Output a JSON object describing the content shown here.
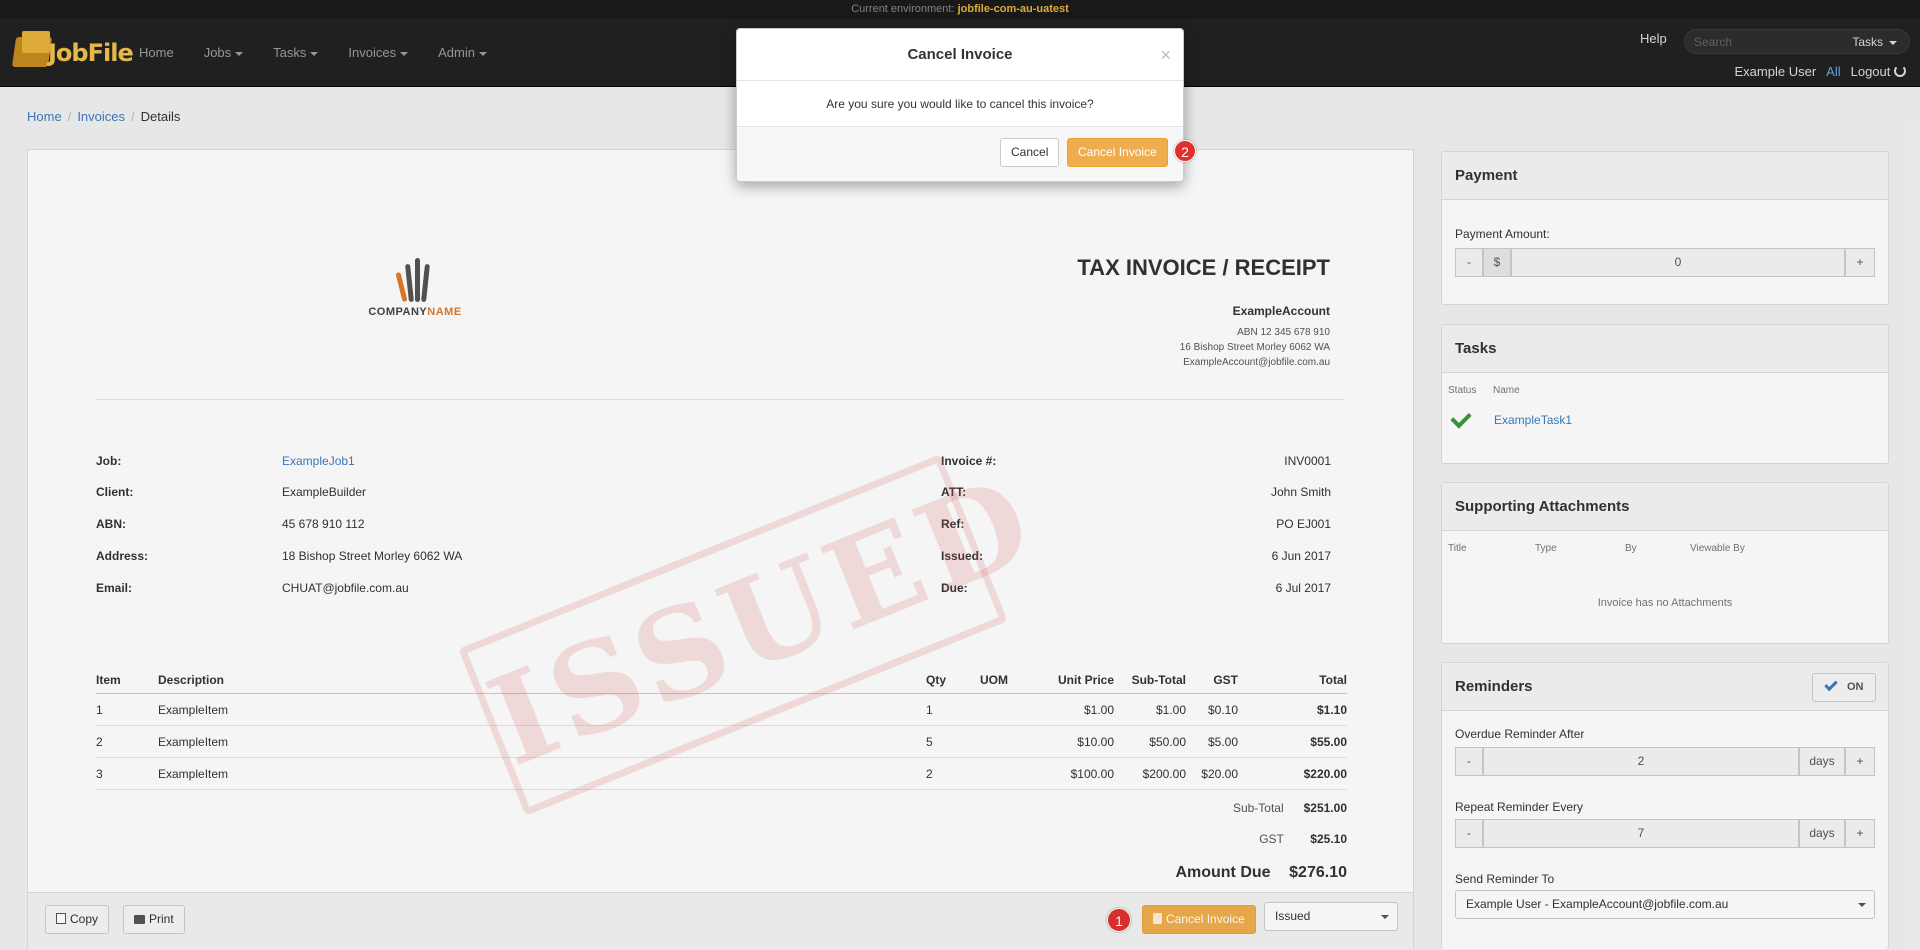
{
  "env": {
    "label": "Current environment:",
    "name": "jobfile-com-au-uatest"
  },
  "nav": {
    "logo_text": "JobFile",
    "items": [
      {
        "label": "Home",
        "dropdown": false
      },
      {
        "label": "Jobs",
        "dropdown": true
      },
      {
        "label": "Tasks",
        "dropdown": true
      },
      {
        "label": "Invoices",
        "dropdown": true
      },
      {
        "label": "Admin",
        "dropdown": true
      }
    ],
    "help": "Help",
    "search_placeholder": "Search",
    "search_scope": "Tasks",
    "user": "Example User",
    "all": "All",
    "logout": "Logout"
  },
  "breadcrumb": {
    "home": "Home",
    "invoices": "Invoices",
    "current": "Details"
  },
  "invoice": {
    "company_logo_a": "COMPANY",
    "company_logo_b": "NAME",
    "title": "TAX INVOICE / RECEIPT",
    "account": {
      "name": "ExampleAccount",
      "abn": "ABN 12 345 678 910",
      "address": "16 Bishop Street Morley 6062 WA",
      "email": "ExampleAccount@jobfile.com.au"
    },
    "stamp": "ISSUED",
    "left_fields": [
      {
        "key": "Job:",
        "value": "ExampleJob1",
        "link": true
      },
      {
        "key": "Client:",
        "value": "ExampleBuilder",
        "link": false
      },
      {
        "key": "ABN:",
        "value": "45 678 910 112",
        "link": false
      },
      {
        "key": "Address:",
        "value": "18 Bishop Street Morley 6062 WA",
        "link": false
      },
      {
        "key": "Email:",
        "value": "CHUAT@jobfile.com.au",
        "link": false
      }
    ],
    "right_fields": [
      {
        "key": "Invoice #:",
        "value": "INV0001"
      },
      {
        "key": "ATT:",
        "value": "John Smith"
      },
      {
        "key": "Ref:",
        "value": "PO EJ001"
      },
      {
        "key": "Issued:",
        "value": "6 Jun 2017"
      },
      {
        "key": "Due:",
        "value": "6 Jul 2017"
      }
    ],
    "columns": [
      "Item",
      "Description",
      "Qty",
      "UOM",
      "Unit Price",
      "Sub-Total",
      "GST",
      "Total"
    ],
    "rows": [
      [
        "1",
        "ExampleItem",
        "1",
        "",
        "$1.00",
        "$1.00",
        "$0.10",
        "$1.10"
      ],
      [
        "2",
        "ExampleItem",
        "5",
        "",
        "$10.00",
        "$50.00",
        "$5.00",
        "$55.00"
      ],
      [
        "3",
        "ExampleItem",
        "2",
        "",
        "$100.00",
        "$200.00",
        "$20.00",
        "$220.00"
      ]
    ],
    "subtotal_label": "Sub-Total",
    "subtotal": "$251.00",
    "gst_label": "GST",
    "gst": "$25.10",
    "amount_due_label": "Amount Due",
    "amount_due": "$276.10"
  },
  "footer": {
    "copy": "Copy",
    "print": "Print",
    "cancel_invoice": "Cancel Invoice",
    "status": "Issued",
    "badge1": "1"
  },
  "payment": {
    "title": "Payment",
    "amount_label": "Payment Amount:",
    "minus": "-",
    "currency": "$",
    "amount": "0",
    "plus": "+"
  },
  "tasks": {
    "title": "Tasks",
    "col_status": "Status",
    "col_name": "Name",
    "rows": [
      {
        "name": "ExampleTask1"
      }
    ]
  },
  "attachments": {
    "title": "Supporting Attachments",
    "columns": [
      "Title",
      "Type",
      "By",
      "Viewable By"
    ],
    "empty": "Invoice has no Attachments"
  },
  "reminders": {
    "title": "Reminders",
    "toggle": "ON",
    "overdue_label": "Overdue Reminder After",
    "overdue_value": "2",
    "repeat_label": "Repeat Reminder Every",
    "repeat_value": "7",
    "unit": "days",
    "minus": "-",
    "plus": "+",
    "send_to_label": "Send Reminder To",
    "send_to_value": "Example User - ExampleAccount@jobfile.com.au"
  },
  "modal": {
    "title": "Cancel Invoice",
    "close": "×",
    "message": "Are you sure you would like to cancel this invoice?",
    "cancel": "Cancel",
    "confirm": "Cancel Invoice",
    "badge2": "2"
  },
  "colors": {
    "accent_orange": "#f0ad4e",
    "link_blue": "#3c7bbf",
    "navbar": "#222222",
    "badge_red": "#e03030",
    "check_green": "#3a9a3a"
  }
}
